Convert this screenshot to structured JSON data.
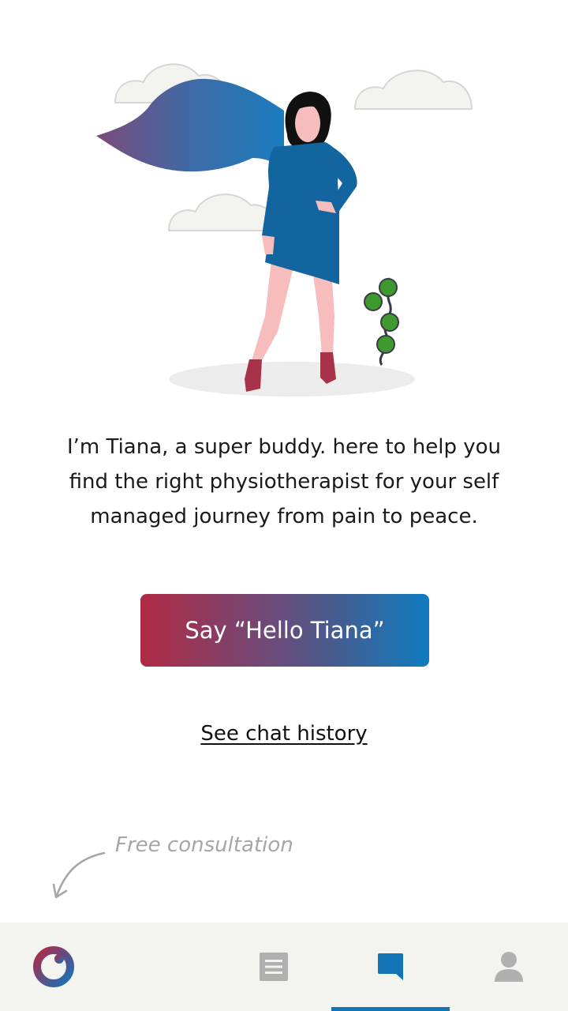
{
  "intro": {
    "text": "I’m Tiana, a super buddy. here to help you find the right physiotherapist for your self managed journey from pain to peace."
  },
  "cta": {
    "label": "Say “Hello Tiana”"
  },
  "history": {
    "label": "See chat history"
  },
  "consultation": {
    "hint": "Free consultation"
  },
  "tabbar": {
    "items": [
      {
        "icon": "logo-ring-icon",
        "active": false
      },
      {
        "icon": "list-icon",
        "active": false
      },
      {
        "icon": "chat-bubble-icon",
        "active": true
      },
      {
        "icon": "person-icon",
        "active": false
      }
    ]
  },
  "colors": {
    "gradient_start": "#b02a44",
    "gradient_end": "#0f7bc0",
    "active_tab": "#1374b5",
    "inactive_icon": "#b0b0b0",
    "tabbar_bg": "#f3f3f0"
  }
}
